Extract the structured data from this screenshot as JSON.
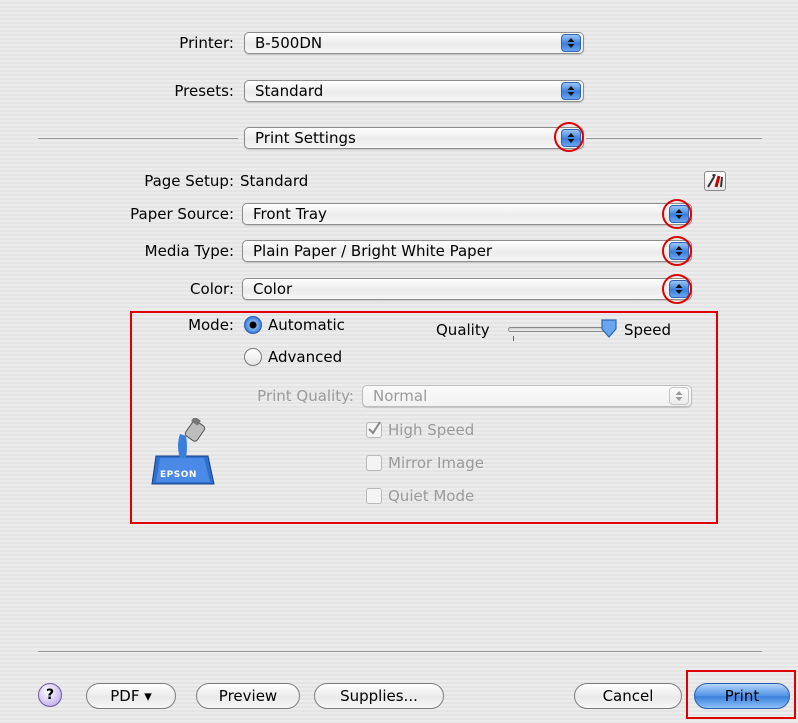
{
  "printer": {
    "label": "Printer:",
    "value": "B-500DN"
  },
  "presets": {
    "label": "Presets:",
    "value": "Standard"
  },
  "panel_selector": {
    "value": "Print Settings"
  },
  "page_setup": {
    "label": "Page Setup:",
    "value": "Standard"
  },
  "paper_source": {
    "label": "Paper Source:",
    "value": "Front Tray"
  },
  "media_type": {
    "label": "Media Type:",
    "value": "Plain Paper / Bright White Paper"
  },
  "color": {
    "label": "Color:",
    "value": "Color"
  },
  "mode": {
    "label": "Mode:",
    "automatic": "Automatic",
    "advanced": "Advanced",
    "selected": "Automatic",
    "slider_left": "Quality",
    "slider_right": "Speed",
    "slider_value": 1.0
  },
  "print_quality": {
    "label": "Print Quality:",
    "value": "Normal"
  },
  "options": {
    "high_speed": {
      "label": "High Speed",
      "checked": true
    },
    "mirror_image": {
      "label": "Mirror Image",
      "checked": false
    },
    "quiet_mode": {
      "label": "Quiet Mode",
      "checked": false
    }
  },
  "logo_text": "EPSON",
  "bottom_bar": {
    "help": "?",
    "pdf": "PDF ▾",
    "preview": "Preview",
    "supplies": "Supplies...",
    "cancel": "Cancel",
    "print": "Print"
  },
  "colors": {
    "highlight_red": "#e00000",
    "aqua_blue": "#3a7fdc"
  }
}
